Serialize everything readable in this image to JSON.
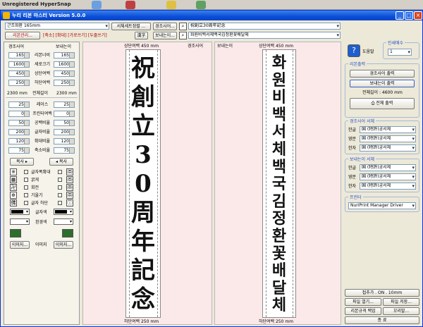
{
  "hypersnap": {
    "title": "Unregistered HyperSnap"
  },
  "window": {
    "title": "누리 리본 마스터 Version 5.0.0",
    "min": "_",
    "max": "□",
    "close": "×"
  },
  "row1": {
    "font_select": "근조화환 165mm",
    "btn_set": "서체세트정렬 ...",
    "btn_gyeongjo": "경조사어...",
    "text1": "祝創立30周年記念"
  },
  "row2": {
    "btn_ribbon": "리본관리...",
    "insert_text": "[축소] [확대] [가로쓰기] [두줄쓰기]",
    "btn_hanja": "漢字",
    "btn_sender": "보내는이...",
    "text2": "화원비백서체백국김정환꽃배달체"
  },
  "left": {
    "col_gyeongjo": "경조사어",
    "col_sender": "보내는이",
    "rows": [
      {
        "l": "165",
        "lab": "리본너비",
        "r": "165"
      },
      {
        "l": "1600",
        "lab": "세로크기",
        "r": "1600"
      },
      {
        "l": "450",
        "lab": "상단여백",
        "r": "450"
      },
      {
        "l": "250",
        "lab": "하단여백",
        "r": "250"
      }
    ],
    "len_l": "2300 mm",
    "len_lab": "전체길이",
    "len_r": "2300 mm",
    "rows2": [
      {
        "l": "25",
        "lab": "레이스",
        "r": "25"
      },
      {
        "l": "0",
        "lab": "프린터여백",
        "r": "0"
      },
      {
        "l": "50",
        "lab": "공백비율",
        "r": "50"
      },
      {
        "l": "200",
        "lab": "글자비율",
        "r": "200"
      },
      {
        "l": "120",
        "lab": "확대비율",
        "r": "120"
      },
      {
        "l": "75",
        "lab": "축소비율",
        "r": "75"
      }
    ],
    "copy_l": "복사",
    "copy_r": "복사",
    "opts": [
      "글자폭확대",
      "굵게",
      "회전",
      "기울기",
      "글자 하단"
    ],
    "lab_color": "글자색",
    "lab_border": "흰경색",
    "btn_img_l": "이미지...",
    "lab_img": "이미지",
    "btn_img_r": "이미지..."
  },
  "preview": {
    "top_margin_l": "상단여백 450 mm",
    "label_l": "경조사어",
    "label_r": "보내는이",
    "top_margin_r": "상단여백 450 mm",
    "chars_l": [
      "祝",
      "創",
      "立",
      "3",
      "0",
      "周",
      "年",
      "記",
      "念"
    ],
    "chars_r": [
      "화",
      "원",
      "비",
      "백",
      "서",
      "체",
      "백",
      "국",
      "김",
      "정",
      "환",
      "꽃",
      "배",
      "달",
      "체"
    ],
    "bottom_margin_l": "하단여백 250 mm",
    "bottom_margin_r": "하단여백 250 mm"
  },
  "right": {
    "help": "도움말",
    "copies_label": "인쇄매수",
    "copies": "1",
    "print_group": "리본출력",
    "btn_print_g": "경조사어 출력",
    "btn_print_s": "보내는이 출력",
    "total_len": "전체길이 : 4600 mm",
    "btn_print_all": "전체 출력",
    "font_g_group": "경조사어 서체",
    "font_s_group": "보내는이 서체",
    "font_rows": [
      {
        "lab": "한글",
        "val": "国 (特許)궁서체"
      },
      {
        "lab": "영문",
        "val": "国 (特許)궁서체"
      },
      {
        "lab": "한자",
        "val": "国 (特許)궁서체"
      }
    ],
    "printer_group": "프린터",
    "printer": "NuriPrint Manager Driver",
    "btn_file_open": "파일 열기...",
    "btn_file_save": "파일 저장...",
    "btn_join": "접추가 . ON . 10mm",
    "btn_backup": "리본규격 백업",
    "btn_restore": "꼬리말...",
    "btn_exit": "종 료"
  }
}
